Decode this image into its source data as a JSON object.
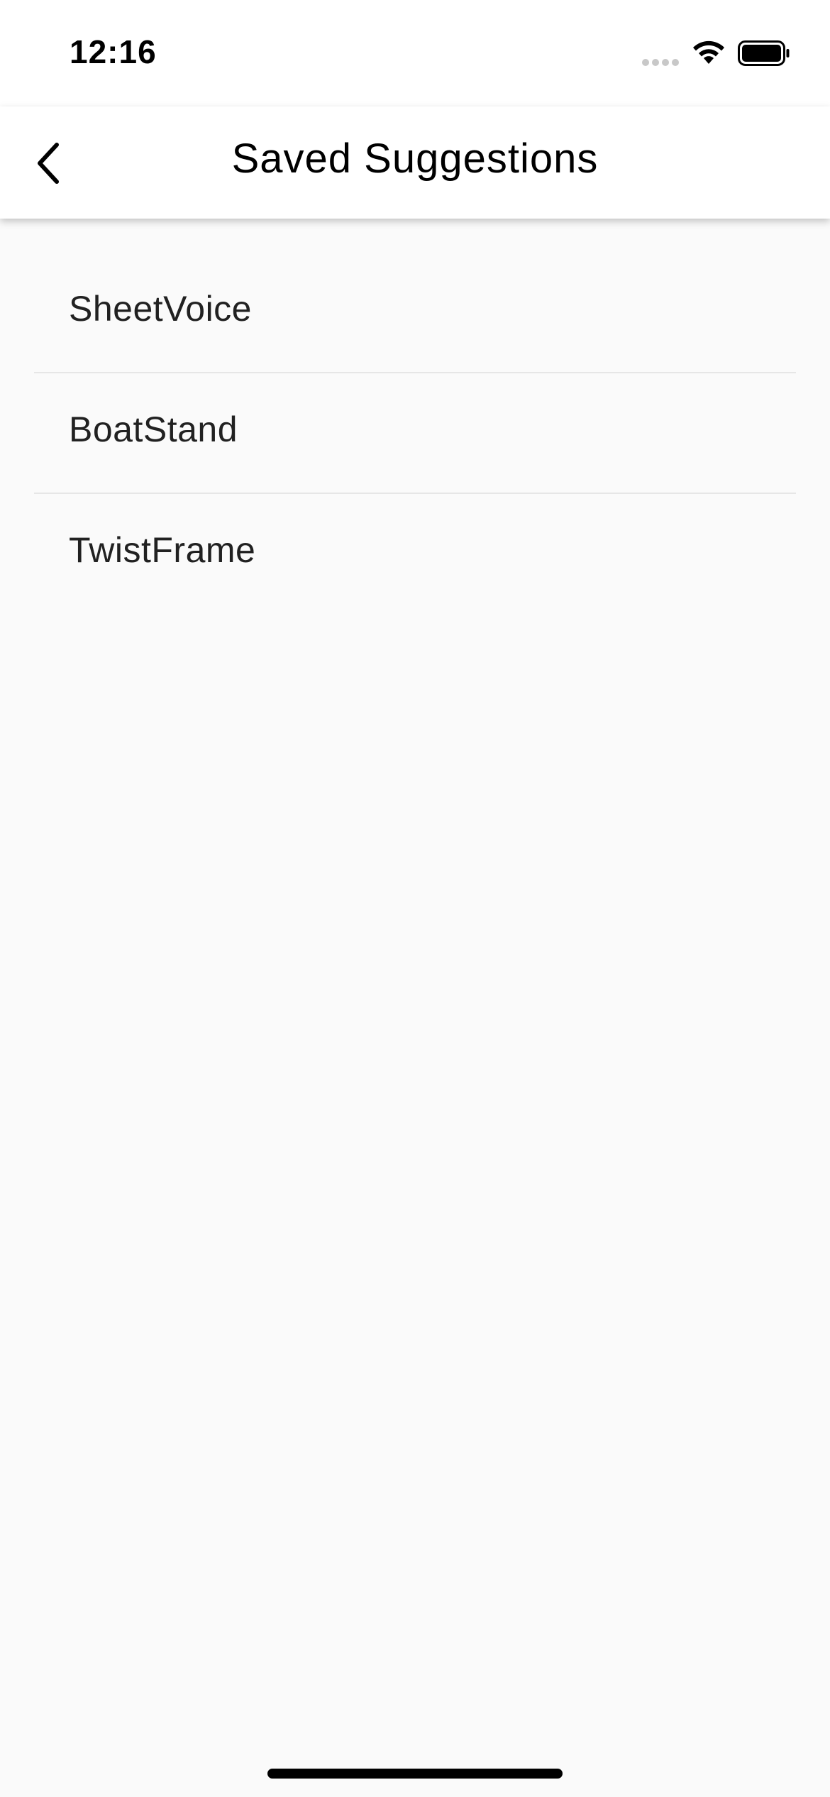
{
  "status_bar": {
    "time": "12:16",
    "signal_icon": "cellular-signal-icon",
    "wifi_icon": "wifi-icon",
    "battery_icon": "battery-icon"
  },
  "app_bar": {
    "title": "Saved Suggestions",
    "back_icon": "chevron-left-icon"
  },
  "saved_list": {
    "items": [
      {
        "label": "SheetVoice"
      },
      {
        "label": "BoatStand"
      },
      {
        "label": "TwistFrame"
      }
    ]
  },
  "colors": {
    "background": "#fafafa",
    "app_bar": "#ffffff",
    "text": "#212121",
    "divider": "#e6e6e6"
  }
}
